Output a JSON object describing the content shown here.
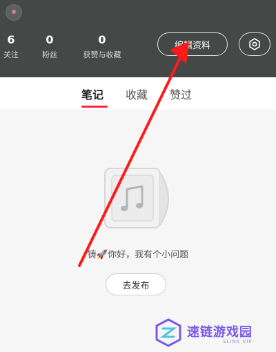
{
  "header": {
    "stats": [
      {
        "value": "6",
        "label": "关注"
      },
      {
        "value": "0",
        "label": "粉丝"
      },
      {
        "value": "0",
        "label": "获赞与收藏"
      }
    ],
    "edit_profile_label": "编辑资料"
  },
  "tabs": [
    {
      "label": "笔记",
      "active": true
    },
    {
      "label": "收藏",
      "active": false
    },
    {
      "label": "赞过",
      "active": false
    }
  ],
  "empty_state": {
    "message": "铸🚀你好，我有个小问题",
    "publish_label": "去发布"
  },
  "watermark": {
    "text": "速链游戏园",
    "sub": "SLINK.VIP"
  },
  "colors": {
    "header_bg": "#444847",
    "accent": "#ff2442",
    "annotation": "#ff1a1a",
    "watermark": "#7b58e8"
  },
  "icons": [
    "settings-icon",
    "music-note-icon"
  ]
}
